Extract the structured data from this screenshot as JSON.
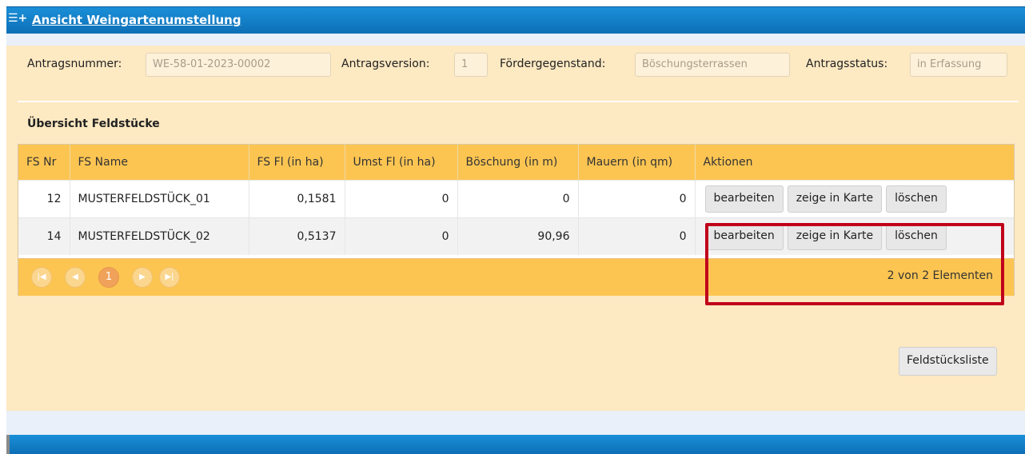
{
  "header": {
    "title": "Ansicht Weingartenumstellung",
    "icon": "list-add-icon"
  },
  "form": {
    "antragsnummer_label": "Antragsnummer:",
    "antragsnummer_value": "WE-58-01-2023-00002",
    "antragsversion_label": "Antragsversion:",
    "antragsversion_value": "1",
    "foerdergegenstand_label": "Fördergegenstand:",
    "foerdergegenstand_value": "Böschungsterrassen",
    "antragsstatus_label": "Antragsstatus:",
    "antragsstatus_value": "in Erfassung"
  },
  "section": {
    "title": "Übersicht Feldstücke"
  },
  "table": {
    "columns": [
      "FS Nr",
      "FS Name",
      "FS Fl (in ha)",
      "Umst Fl (in ha)",
      "Böschung (in m)",
      "Mauern (in qm)",
      "Aktionen"
    ],
    "rows": [
      {
        "nr": "12",
        "name": "MUSTERFELDSTÜCK_01",
        "fs_fl": "0,1581",
        "umst_fl": "0",
        "boeschung": "0",
        "mauern": "0"
      },
      {
        "nr": "14",
        "name": "MUSTERFELDSTÜCK_02",
        "fs_fl": "0,5137",
        "umst_fl": "0",
        "boeschung": "90,96",
        "mauern": "0"
      }
    ],
    "actions": {
      "edit": "bearbeiten",
      "map": "zeige in Karte",
      "delete": "löschen"
    }
  },
  "pager": {
    "current_page": "1",
    "info": "2 von 2 Elementen"
  },
  "buttons": {
    "feldstuecksliste": "Feldstücksliste"
  },
  "colors": {
    "header_blue": "#1a8fd8",
    "panel": "#fde9c2",
    "grid_header": "#fcc552",
    "highlight": "#c0001a"
  }
}
